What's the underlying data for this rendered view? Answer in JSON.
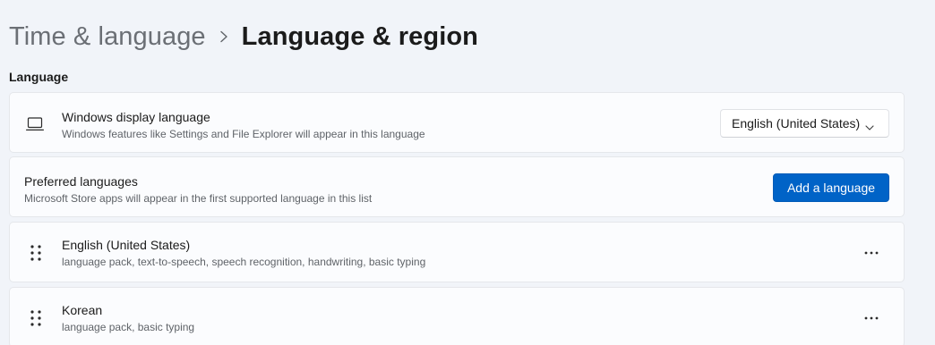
{
  "breadcrumb": {
    "parent": "Time & language",
    "current": "Language & region"
  },
  "section": {
    "title": "Language"
  },
  "display_language": {
    "icon": "laptop-icon",
    "title": "Windows display language",
    "subtitle": "Windows features like Settings and File Explorer will appear in this language",
    "selected": "English (United States)"
  },
  "preferred_languages": {
    "title": "Preferred languages",
    "subtitle": "Microsoft Store apps will appear in the first supported language in this list",
    "add_button": "Add a language"
  },
  "languages": [
    {
      "name": "English (United States)",
      "features": "language pack, text-to-speech, speech recognition, handwriting, basic typing"
    },
    {
      "name": "Korean",
      "features": "language pack, basic typing"
    }
  ],
  "colors": {
    "accent": "#0063c7",
    "background": "#f1f4f9",
    "card": "#fbfcfe"
  }
}
